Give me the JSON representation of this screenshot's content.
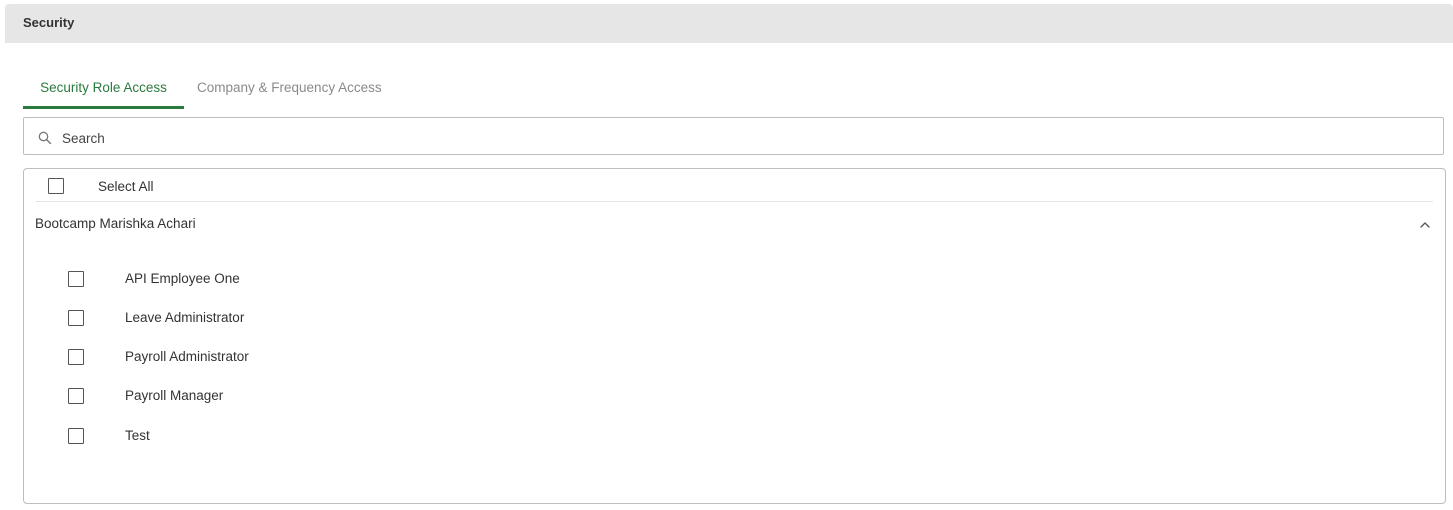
{
  "header": {
    "title": "Security"
  },
  "tabs": [
    {
      "label": "Security Role Access",
      "active": true
    },
    {
      "label": "Company & Frequency Access",
      "active": false
    }
  ],
  "search": {
    "placeholder": "Search",
    "value": ""
  },
  "role_list": {
    "select_all_label": "Select All",
    "select_all_checked": false,
    "group": {
      "title": "Bootcamp Marishka Achari",
      "expanded": true,
      "items": [
        {
          "label": "API Employee One",
          "checked": false
        },
        {
          "label": "Leave Administrator",
          "checked": false
        },
        {
          "label": "Payroll Administrator",
          "checked": false
        },
        {
          "label": "Payroll Manager",
          "checked": false
        },
        {
          "label": "Test",
          "checked": false
        }
      ]
    }
  },
  "colors": {
    "accent": "#2b7a3d",
    "header_bg": "#e6e6e6",
    "border": "#bdbdbd",
    "inactive_tab": "#8a8a8a"
  },
  "icons": {
    "search": "search-icon",
    "collapse": "chevron-up-icon"
  }
}
